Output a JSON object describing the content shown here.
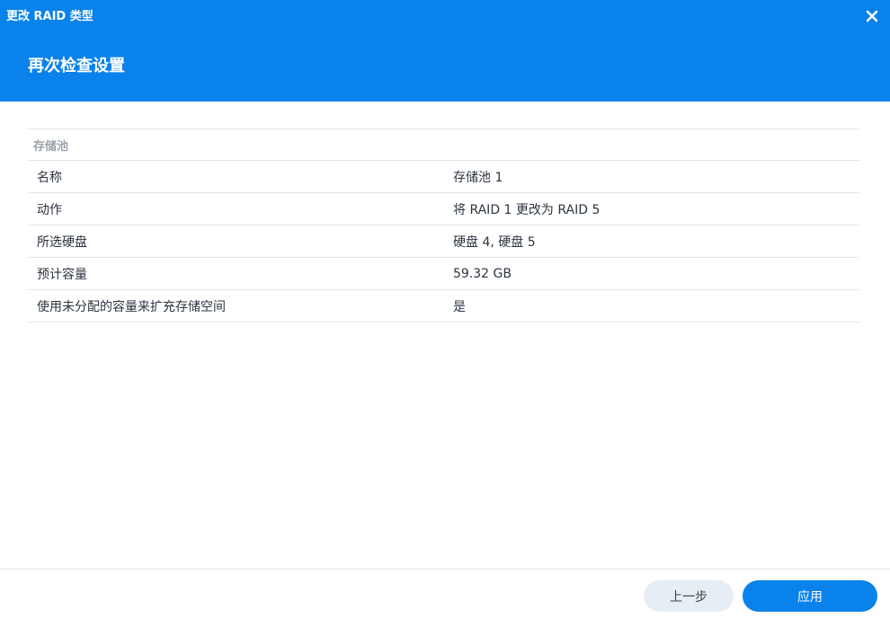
{
  "window": {
    "title": "更改 RAID 类型",
    "close_icon": "close-icon"
  },
  "header": {
    "step_title": "再次检查设置",
    "background_color": "#0a82eb"
  },
  "summary": {
    "section_title": "存储池",
    "rows": [
      {
        "label": "名称",
        "value": "存储池 1"
      },
      {
        "label": "动作",
        "value": "将 RAID 1 更改为 RAID 5"
      },
      {
        "label": "所选硬盘",
        "value": "硬盘 4, 硬盘 5"
      },
      {
        "label": "预计容量",
        "value": "59.32 GB"
      },
      {
        "label": "使用未分配的容量来扩充存储空间",
        "value": "是"
      }
    ]
  },
  "footer": {
    "back_label": "上一步",
    "apply_label": "应用",
    "accent_color": "#0a82eb"
  }
}
